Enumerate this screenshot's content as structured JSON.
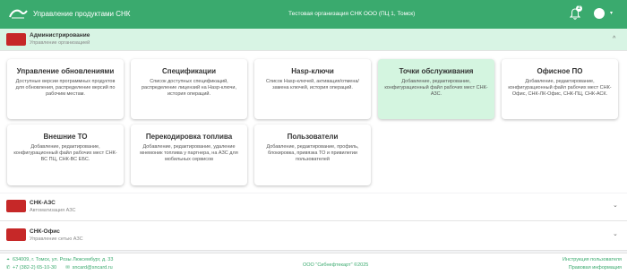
{
  "header": {
    "app_title": "Управление продуктами СНК",
    "organization": "Тестовая организация СНК ООО (ПЦ 1, Томск)",
    "notifications_count": "2",
    "brand_color": "#3aaa6e"
  },
  "sections": [
    {
      "title": "Администрирование",
      "subtitle": "Управление организацией",
      "expanded": true,
      "chevron": "^"
    },
    {
      "title": "СНК-АЗС",
      "subtitle": "Автоматизация АЗС",
      "expanded": false,
      "chevron": "⌄"
    },
    {
      "title": "СНК-Офис",
      "subtitle": "Управление сетью АЗС",
      "expanded": false,
      "chevron": "⌄"
    }
  ],
  "cards": [
    {
      "title": "Управление обновлениями",
      "desc": "Доступные версии программных продуктов для обновления, распределение версий по рабочим местам."
    },
    {
      "title": "Спецификации",
      "desc": "Список доступных спецификаций, распределение лицензий на Hasp-ключи, история операций."
    },
    {
      "title": "Hasp-ключи",
      "desc": "Список Hasp-ключей, активация/отмена/замена ключей, история операций."
    },
    {
      "title": "Точки обслуживания",
      "desc": "Добавление, редактирование, конфигурационный файл рабочих мест СНК-АЗС.",
      "selected": true
    },
    {
      "title": "Офисное ПО",
      "desc": "Добавление, редактирование, конфигурационный файл рабочих мест СНК-Офис, СНК-ЛК-Офис, СНК-ПЦ, СНК-АСК."
    },
    {
      "title": "Внешние ТО",
      "desc": "Добавление, редактирование, конфигурационный файл рабочих мест СНК-ВС ПЦ, СНК-ВС ЕБС."
    },
    {
      "title": "Перекодировка топлива",
      "desc": "Добавление, редактирование, удаление мнемоник топлива у партнера, на АЗС для мобильных сервисов"
    },
    {
      "title": "Пользователи",
      "desc": "Добавление, редактирование, профиль, блокировка, привязка ТО и привилегии пользователей"
    }
  ],
  "footer": {
    "address": "634009, г. Томск, ул. Розы Люксембург, д. 33",
    "phone": "+7 (382-2) 65-10-30",
    "email": "sncard@sncard.ru",
    "copyright": "ООО \"Сибнефтекарт\" ©2025",
    "link_manual": "Инструкция пользователя",
    "link_legal": "Правовая информация"
  }
}
